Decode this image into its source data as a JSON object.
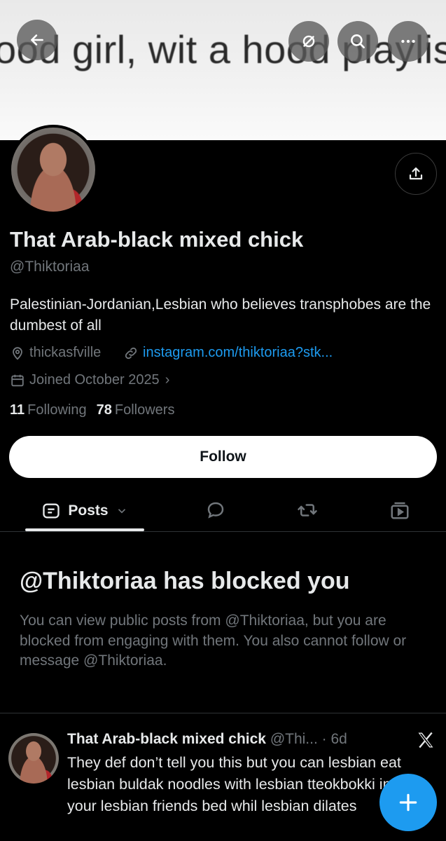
{
  "banner": {
    "text": "ood girl, wit a hood playlist"
  },
  "profile": {
    "display_name": "That Arab-black mixed chick",
    "handle": "@Thiktoriaa",
    "bio": "Palestinian-Jordanian,Lesbian who believes transphobes are the dumbest of all",
    "location": "thickasfville",
    "link": "instagram.com/thiktoriaa?stk...",
    "joined": "Joined October 2025",
    "following_count": "11",
    "following_label": "Following",
    "followers_count": "78",
    "followers_label": "Followers"
  },
  "actions": {
    "follow_label": "Follow"
  },
  "tabs": {
    "posts_label": "Posts"
  },
  "blocked": {
    "title": "@Thiktoriaa has blocked you",
    "description": "You can view public posts from @Thiktoriaa, but you are blocked from engaging with them. You also cannot follow or message @Thiktoriaa."
  },
  "post": {
    "author": "That Arab-black mixed chick",
    "meta": " @Thi... · 6d",
    "text": "They def don’t tell you this but you can lesbian eat lesbian buldak noodles with lesbian tteokbokki in your lesbian friends bed whil lesbian dilates"
  },
  "icons": {
    "back": "arrow-left-icon",
    "mute": "mute-icon",
    "search": "search-icon",
    "more": "more-icon",
    "share": "share-icon",
    "location": "location-pin-icon",
    "link": "link-icon",
    "calendar": "calendar-icon",
    "replies": "speech-bubble-icon",
    "reposts": "repost-icon",
    "media": "media-icon",
    "compose": "plus-icon",
    "brand": "x-logo-icon"
  },
  "colors": {
    "accent": "#1d9bf0",
    "background": "#000000",
    "secondary_text": "#71767b"
  }
}
